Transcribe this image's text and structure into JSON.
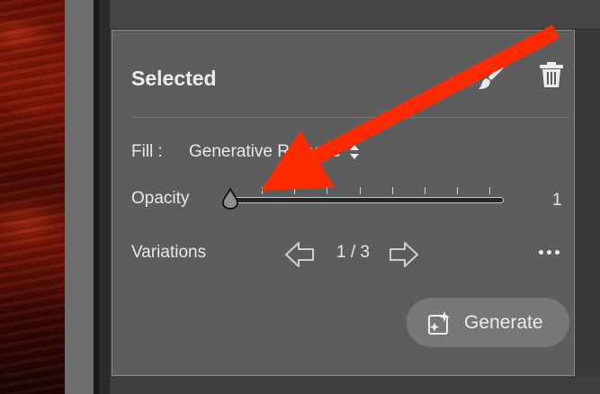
{
  "panel": {
    "title": "Selected",
    "fill": {
      "label": "Fill :",
      "value": "Generative Remove"
    },
    "opacity": {
      "label": "Opacity",
      "value": "1",
      "level_fraction": 0.0
    },
    "variations": {
      "label": "Variations",
      "count": "1 / 3"
    },
    "generate_label": "Generate"
  },
  "icons": {
    "brush": "brush-icon",
    "trash": "trash-icon",
    "prev": "arrow-left-icon",
    "next": "arrow-right-icon",
    "more": "more-horizontal-icon",
    "generate": "generate-sparkle-icon"
  },
  "colors": {
    "panel_bg": "#5d5d5d",
    "annotation_red": "#ff2a00",
    "button_bg": "#777777"
  }
}
